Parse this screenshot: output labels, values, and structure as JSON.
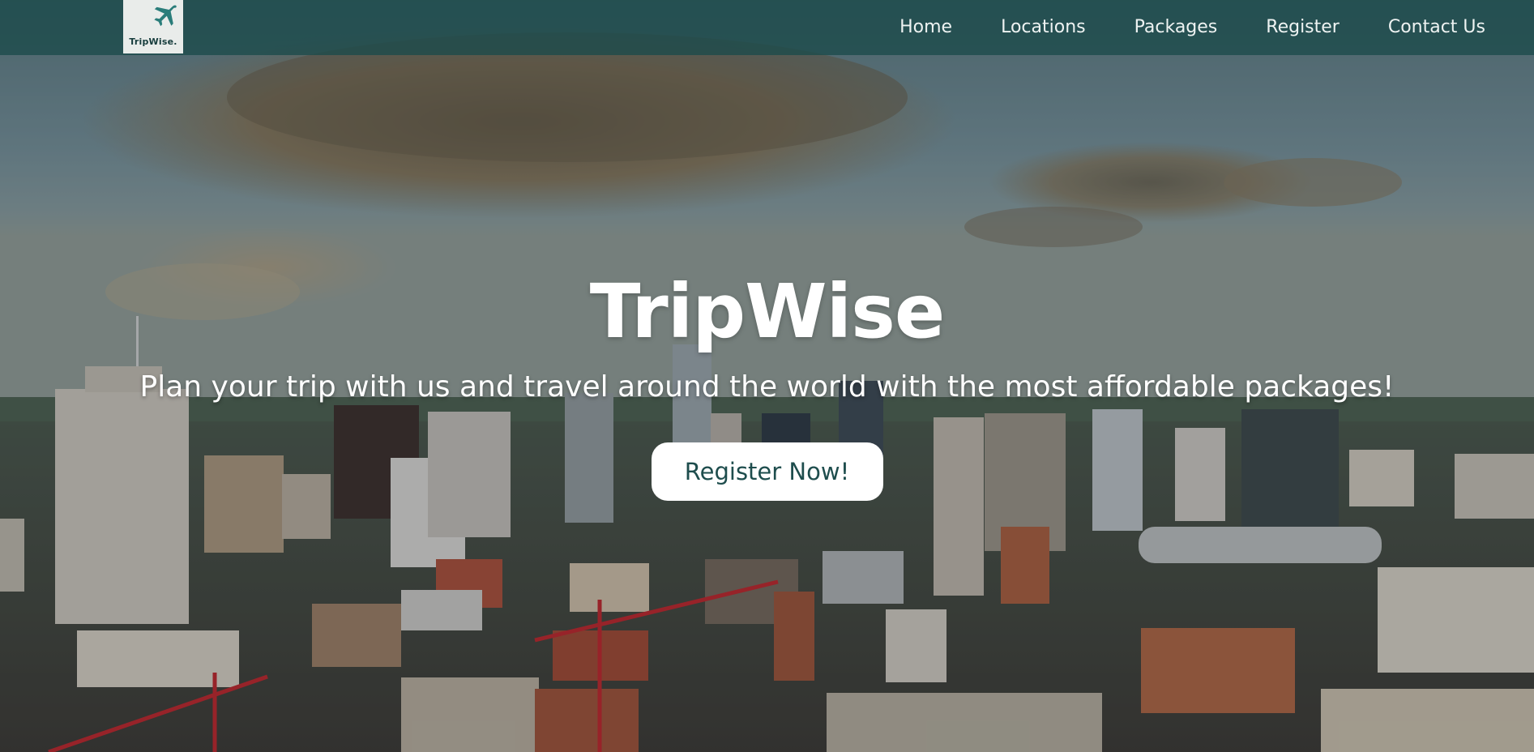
{
  "brand": {
    "logo_text": "TripWise.",
    "logo_icon": "airplane-icon",
    "accent_color": "#1e4d4d"
  },
  "nav": {
    "items": [
      {
        "label": "Home"
      },
      {
        "label": "Locations"
      },
      {
        "label": "Packages"
      },
      {
        "label": "Register"
      },
      {
        "label": "Contact Us"
      }
    ]
  },
  "hero": {
    "title": "TripWise",
    "tagline": "Plan your trip with us and travel around the world with the most affordable packages!",
    "cta_label": "Register Now!",
    "background": "city-skyline-aerial-photo"
  }
}
